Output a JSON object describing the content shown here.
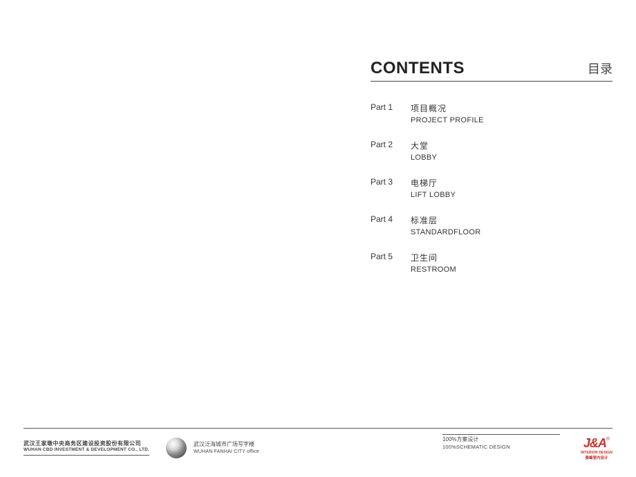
{
  "header": {
    "title_en": "CONTENTS",
    "title_zh": "目录"
  },
  "toc": [
    {
      "part": "Part 1",
      "zh": "项目概况",
      "en": "PROJECT PROFILE"
    },
    {
      "part": "Part 2",
      "zh": "大堂",
      "en": "LOBBY"
    },
    {
      "part": "Part 3",
      "zh": "电梯厅",
      "en": "LIFT LOBBY"
    },
    {
      "part": "Part 4",
      "zh": "标准层",
      "en": "STANDARDFLOOR"
    },
    {
      "part": "Part 5",
      "zh": "卫生间",
      "en": "RESTROOM"
    }
  ],
  "footer": {
    "company_zh": "武汉王家墩中央商务区建设投资股份有限公司",
    "company_en": "WUHAN CBD INVESTMENT & DEVELOPMENT CO., LTD.",
    "project_zh": "武汉泛海城市广场写字楼",
    "project_en": "WUHAN FANHAI CITY office",
    "schematic_zh": "100%方案设计",
    "schematic_en": "100%SCHEMATIC DESIGN",
    "logo_text": "J&A",
    "logo_reg": "®",
    "logo_sub1": "INTERIOR DESIGN",
    "logo_sub2": "姜峰室内设计"
  }
}
